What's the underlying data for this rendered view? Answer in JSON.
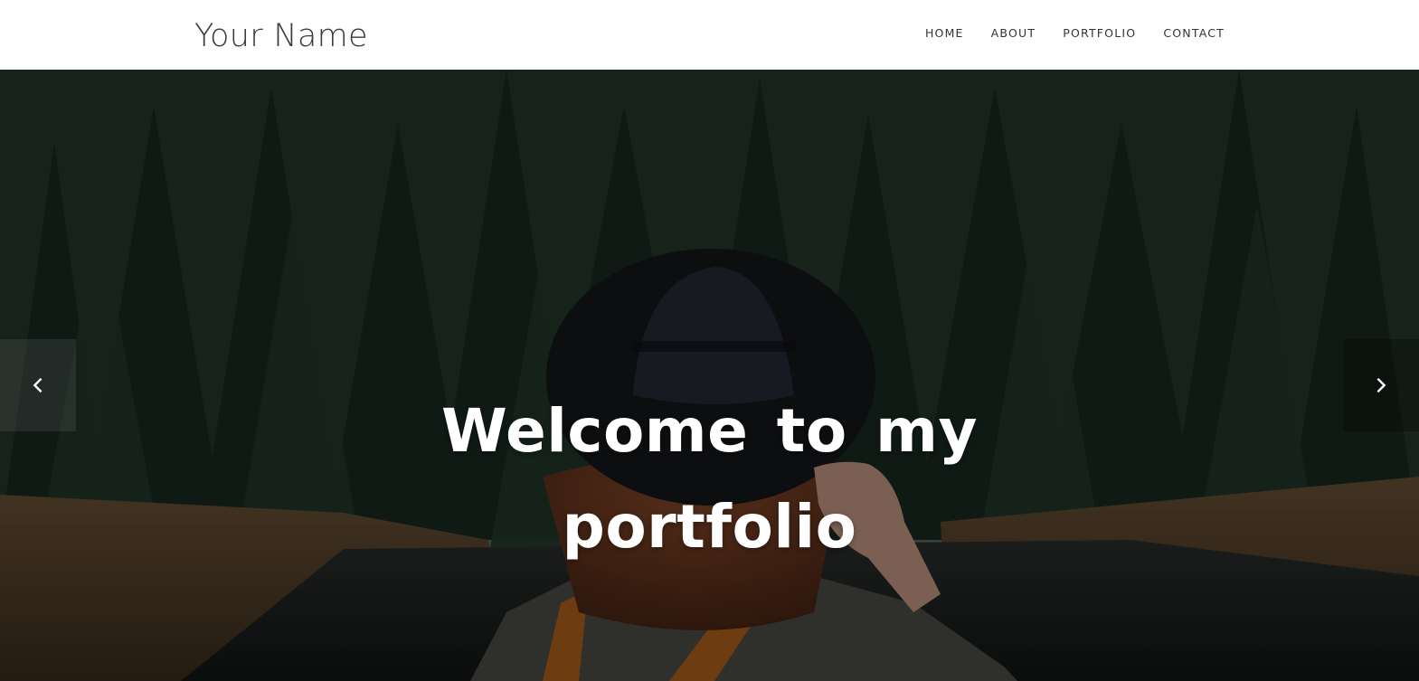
{
  "brand": {
    "name": "Your Name"
  },
  "nav": {
    "items": [
      {
        "label": "HOME"
      },
      {
        "label": "ABOUT"
      },
      {
        "label": "PORTFOLIO"
      },
      {
        "label": "CONTACT"
      }
    ]
  },
  "hero": {
    "title_line1": "Welcome to my",
    "title_line2": "portfolio",
    "prev_icon": "chevron-left-icon",
    "next_icon": "chevron-right-icon"
  },
  "colors": {
    "nav_background": "#ffffff",
    "nav_text": "#333333",
    "hero_title": "#ffffff"
  }
}
